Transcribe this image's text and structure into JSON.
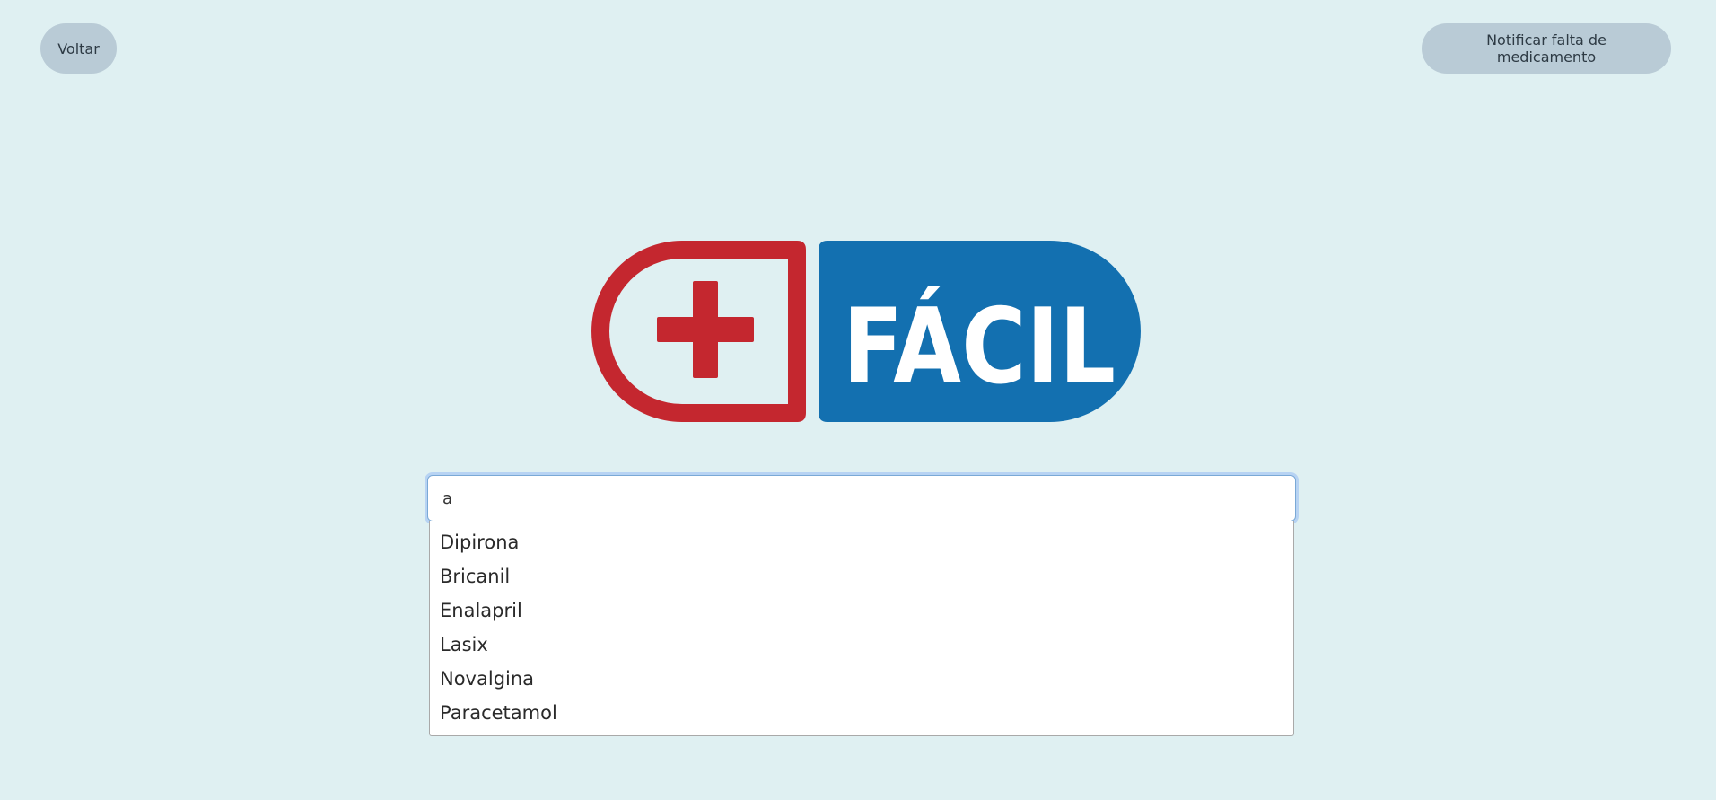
{
  "header": {
    "back_label": "Voltar",
    "notify_label": "Notificar falta de medicamento"
  },
  "logo": {
    "text": "FÁCIL",
    "colors": {
      "red": "#c4272f",
      "blue": "#1370b0",
      "white": "#ffffff"
    }
  },
  "search": {
    "value": "a",
    "placeholder": ""
  },
  "suggestions": [
    {
      "label": "Dipirona"
    },
    {
      "label": "Bricanil"
    },
    {
      "label": "Enalapril"
    },
    {
      "label": "Lasix"
    },
    {
      "label": "Novalgina"
    },
    {
      "label": "Paracetamol"
    }
  ],
  "colors": {
    "background": "#dff0f2",
    "button_bg": "#b9cbd6",
    "focus_ring": "#b7d3f3"
  }
}
